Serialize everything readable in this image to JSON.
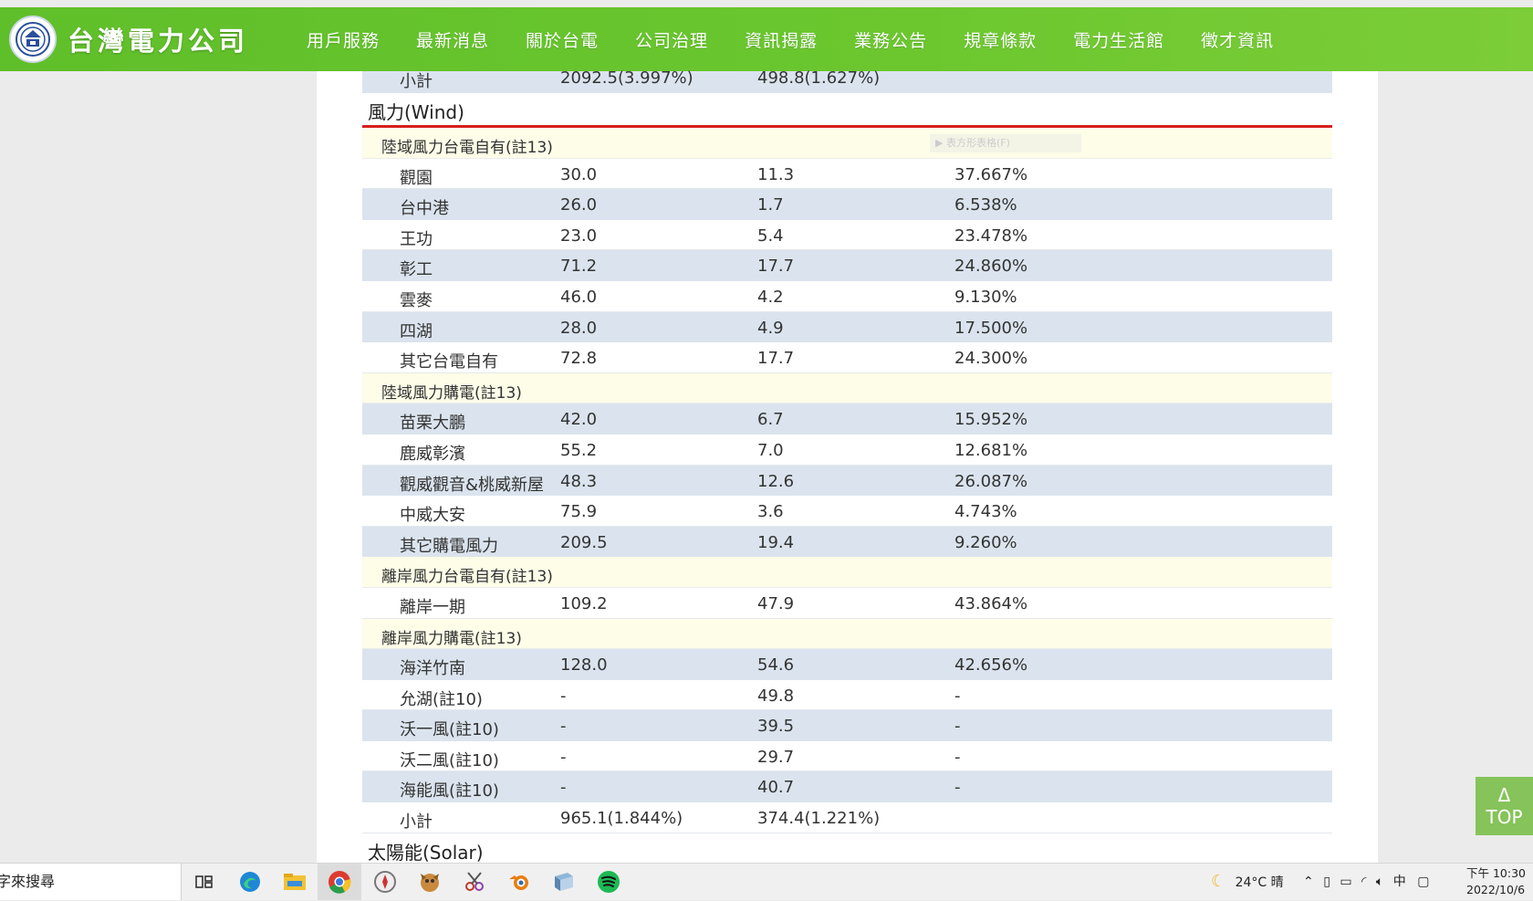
{
  "header": {
    "company_name": "台灣電力公司",
    "nav": [
      "用戶服務",
      "最新消息",
      "關於台電",
      "公司治理",
      "資訊揭露",
      "業務公告",
      "規章條款",
      "電力生活館",
      "徵才資訊"
    ]
  },
  "table": {
    "top_row": {
      "name": "小計",
      "capacity": "2092.5(3.997%)",
      "generation": "498.8(1.627%)"
    },
    "wind_section": "風力(Wind)",
    "ghost_text": "▶ 表方形表格(F)",
    "groups": [
      {
        "label": "陸域風力台電自有(註13)",
        "rows": [
          {
            "name": "觀園",
            "capacity": "30.0",
            "generation": "11.3",
            "factor": "37.667%"
          },
          {
            "name": "台中港",
            "capacity": "26.0",
            "generation": "1.7",
            "factor": "6.538%"
          },
          {
            "name": "王功",
            "capacity": "23.0",
            "generation": "5.4",
            "factor": "23.478%"
          },
          {
            "name": "彰工",
            "capacity": "71.2",
            "generation": "17.7",
            "factor": "24.860%"
          },
          {
            "name": "雲麥",
            "capacity": "46.0",
            "generation": "4.2",
            "factor": "9.130%"
          },
          {
            "name": "四湖",
            "capacity": "28.0",
            "generation": "4.9",
            "factor": "17.500%"
          },
          {
            "name": "其它台電自有",
            "capacity": "72.8",
            "generation": "17.7",
            "factor": "24.300%"
          }
        ]
      },
      {
        "label": "陸域風力購電(註13)",
        "rows": [
          {
            "name": "苗栗大鵬",
            "capacity": "42.0",
            "generation": "6.7",
            "factor": "15.952%"
          },
          {
            "name": "鹿威彰濱",
            "capacity": "55.2",
            "generation": "7.0",
            "factor": "12.681%"
          },
          {
            "name": "觀威觀音&桃威新屋",
            "capacity": "48.3",
            "generation": "12.6",
            "factor": "26.087%"
          },
          {
            "name": "中威大安",
            "capacity": "75.9",
            "generation": "3.6",
            "factor": "4.743%"
          },
          {
            "name": "其它購電風力",
            "capacity": "209.5",
            "generation": "19.4",
            "factor": "9.260%"
          }
        ]
      },
      {
        "label": "離岸風力台電自有(註13)",
        "rows": [
          {
            "name": "離岸一期",
            "capacity": "109.2",
            "generation": "47.9",
            "factor": "43.864%"
          }
        ]
      },
      {
        "label": "離岸風力購電(註13)",
        "rows": [
          {
            "name": "海洋竹南",
            "capacity": "128.0",
            "generation": "54.6",
            "factor": "42.656%"
          },
          {
            "name": "允湖(註10)",
            "capacity": "-",
            "generation": "49.8",
            "factor": "-"
          },
          {
            "name": "沃一風(註10)",
            "capacity": "-",
            "generation": "39.5",
            "factor": "-"
          },
          {
            "name": "沃二風(註10)",
            "capacity": "-",
            "generation": "29.7",
            "factor": "-"
          },
          {
            "name": "海能風(註10)",
            "capacity": "-",
            "generation": "40.7",
            "factor": "-"
          }
        ]
      }
    ],
    "subtotal": {
      "name": "小計",
      "capacity": "965.1(1.844%)",
      "generation": "374.4(1.221%)"
    },
    "solar_section": "太陽能(Solar)"
  },
  "top_button": {
    "arrow": "Δ",
    "label": "TOP"
  },
  "taskbar": {
    "search_text": "字來搜尋",
    "weather": "24°C 晴",
    "ime": "中",
    "time": "下午 10:30",
    "date": "2022/10/6"
  }
}
